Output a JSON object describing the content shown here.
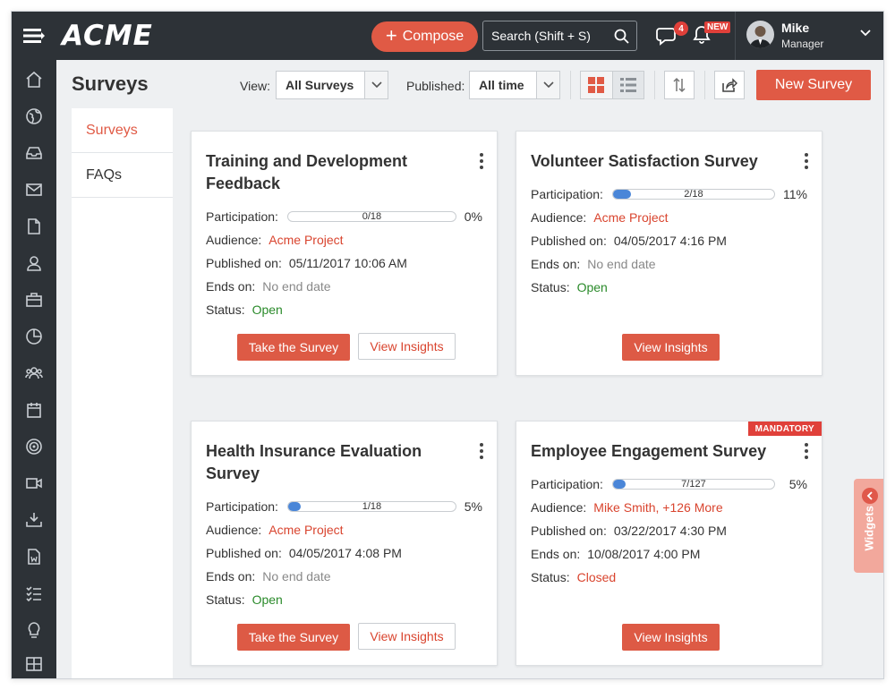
{
  "header": {
    "logo": "ACME",
    "compose_label": "Compose",
    "search_placeholder": "Search (Shift + S)",
    "chat_badge": "4",
    "notif_badge": "NEW",
    "user": {
      "name": "Mike",
      "role": "Manager"
    }
  },
  "sidebar": {
    "items": [
      "home-icon",
      "globe-icon",
      "inbox-icon",
      "mail-icon",
      "document-icon",
      "user-icon",
      "briefcase-icon",
      "pie-chart-icon",
      "team-icon",
      "calendar-icon",
      "target-icon",
      "video-icon",
      "download-icon",
      "word-doc-icon",
      "checklist-icon",
      "lightbulb-icon",
      "grid-icon"
    ]
  },
  "toolbar": {
    "page_title": "Surveys",
    "view_label": "View:",
    "view_value": "All Surveys",
    "published_label": "Published:",
    "published_value": "All time",
    "new_survey": "New Survey"
  },
  "subnav": {
    "items": [
      "Surveys",
      "FAQs"
    ]
  },
  "labels": {
    "participation": "Participation:",
    "audience": "Audience:",
    "published_on": "Published on:",
    "ends_on": "Ends on:",
    "status": "Status:",
    "take_survey": "Take the Survey",
    "view_insights": "View Insights",
    "mandatory": "MANDATORY"
  },
  "cards": [
    {
      "title": "Training and Development Feedback",
      "participation": "0/18",
      "participation_fraction": 0.0,
      "percent": "0%",
      "audience": "Acme Project",
      "published_on": "05/11/2017 10:06 AM",
      "ends_on": "No end date",
      "status": "Open"
    },
    {
      "title": "Volunteer Satisfaction Survey",
      "participation": "2/18",
      "participation_fraction": 0.11,
      "percent": "11%",
      "audience": "Acme Project",
      "published_on": "04/05/2017 4:16 PM",
      "ends_on": "No end date",
      "status": "Open"
    },
    {
      "title": "Health Insurance Evaluation Survey",
      "participation": "1/18",
      "participation_fraction": 0.05,
      "percent": "5%",
      "audience": "Acme Project",
      "published_on": "04/05/2017 4:08 PM",
      "ends_on": "No end date",
      "status": "Open"
    },
    {
      "title": "Employee Engagement Survey",
      "participation": "7/127",
      "participation_fraction": 0.05,
      "percent": "5%",
      "audience": "Mike Smith, +126 More",
      "published_on": "03/22/2017 4:30 PM",
      "ends_on": "10/08/2017 4:00 PM",
      "status": "Closed"
    }
  ],
  "widgets_label": "Widgets",
  "colors": {
    "accent": "#e05a45",
    "sidebar": "#2d3237",
    "progress": "#4a86d8",
    "open": "#2a8a2a",
    "closed": "#d9442e"
  }
}
